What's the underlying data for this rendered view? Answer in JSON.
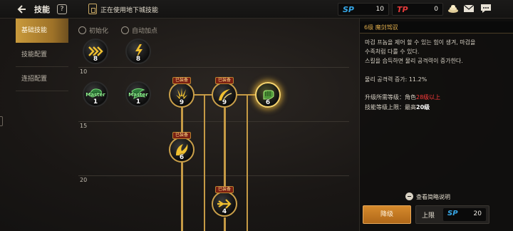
{
  "header": {
    "title": "技能",
    "help": "?",
    "status": "正在使用地下城技能",
    "sp_label": "SP",
    "sp_value": "10",
    "tp_label": "TP",
    "tp_value": "0",
    "sp_color": "#35a6e6",
    "tp_color": "#e23a3a"
  },
  "tabs": [
    {
      "label": "基础技能",
      "active": true
    },
    {
      "label": "技能配置",
      "active": false
    },
    {
      "label": "连招配置",
      "active": false
    }
  ],
  "tree": {
    "reset_label": "初始化",
    "auto_label": "自动加点",
    "levels": [
      "10",
      "15",
      "20"
    ],
    "equip_tag": "已装备",
    "master_tag": "Master",
    "skills": [
      {
        "id": "row1-a",
        "level": "8",
        "icon": "triple-arrow-icon"
      },
      {
        "id": "row1-b",
        "level": "8",
        "icon": "lightning-claw-icon"
      },
      {
        "id": "master-1",
        "level": "1",
        "icon": "shield-wing-icon",
        "master": true
      },
      {
        "id": "master-2",
        "level": "1",
        "icon": "dragon-wing-icon",
        "master": true
      },
      {
        "id": "equipped-1",
        "level": "9",
        "icon": "sword-burst-icon",
        "equipped": true
      },
      {
        "id": "equipped-2",
        "level": "9",
        "icon": "crescent-slash-icon",
        "equipped": true
      },
      {
        "id": "selected",
        "level": "6",
        "icon": "gauntlet-icon",
        "selected": true
      },
      {
        "id": "equipped-3",
        "level": "6",
        "icon": "eagle-strike-icon",
        "equipped": true
      },
      {
        "id": "equipped-4",
        "level": "4",
        "icon": "trident-icon",
        "equipped": true
      }
    ]
  },
  "detail": {
    "title": "6级 魔剑驾驭",
    "desc": [
      "마검 프놈을 제어 할 수 있는 힘이 생겨, 마검을",
      "수족처럼 다룰 수 있다.",
      "스킬을 습득하면 물리 공격력이 증가한다."
    ],
    "effect": "물리 공격력 증가: 11.2%",
    "req_label": "升级所需等级：",
    "req_prefix": "角色",
    "req_value": "28级以上",
    "max_label": "技能等级上限：",
    "max_prefix": "最高",
    "max_value": "20级",
    "link": "查看简略说明",
    "btn_down": "降级",
    "btn_up": "上限",
    "btn_sp_label": "SP",
    "btn_sp_value": "20"
  }
}
